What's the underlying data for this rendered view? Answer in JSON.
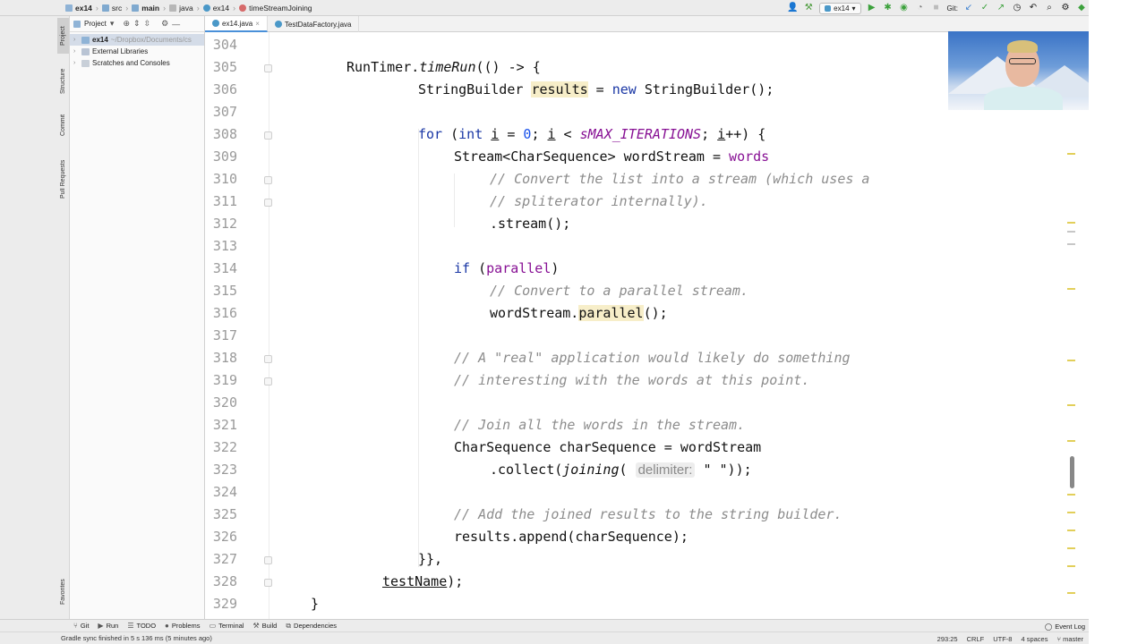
{
  "breadcrumb": [
    {
      "label": "ex14",
      "icon": "folder-icon"
    },
    {
      "label": "src",
      "icon": "source-folder-icon"
    },
    {
      "label": "main",
      "icon": "source-folder-icon"
    },
    {
      "label": "java",
      "icon": "package-icon"
    },
    {
      "label": "ex14",
      "icon": "class-icon"
    },
    {
      "label": "timeStreamJoining",
      "icon": "method-icon"
    }
  ],
  "toolbar": {
    "run_config": "ex14",
    "git_label": "Git:"
  },
  "left_stripe": {
    "project": "Project",
    "structure": "Structure",
    "commit": "Commit",
    "pull_requests": "Pull Requests",
    "favorites": "Favorites"
  },
  "project_panel": {
    "title": "Project",
    "tree": [
      {
        "label": "ex14",
        "sub": "~/Dropbox/Documents/cs",
        "selected": true
      },
      {
        "label": "External Libraries",
        "sub": ""
      },
      {
        "label": "Scratches and Consoles",
        "sub": ""
      }
    ]
  },
  "editor_tabs": [
    {
      "label": "ex14.java",
      "active": true
    },
    {
      "label": "TestDataFactory.java",
      "active": false
    }
  ],
  "editor": {
    "line_numbers": [
      "304",
      "305",
      "306",
      "307",
      "308",
      "309",
      "310",
      "311",
      "312",
      "313",
      "314",
      "315",
      "316",
      "317",
      "318",
      "319",
      "320",
      "321",
      "322",
      "323",
      "324",
      "325",
      "326",
      "327",
      "328",
      "329"
    ],
    "lines": {
      "l305a": "RunTimer.",
      "l305b": "timeRun",
      "l305c": "(() -> {",
      "l306a": "StringBuilder ",
      "l306b": "results",
      "l306c": " = ",
      "l306d": "new",
      "l306e": " StringBuilder();",
      "l308a": "for",
      "l308b": " (",
      "l308c": "int",
      "l308d": " ",
      "l308e": "i",
      "l308f": " = ",
      "l308g": "0",
      "l308h": "; ",
      "l308i": "i",
      "l308j": " < ",
      "l308k": "sMAX_ITERATIONS",
      "l308l": "; ",
      "l308m": "i",
      "l308n": "++) {",
      "l309a": "Stream<CharSequence> wordStream = ",
      "l309b": "words",
      "l310": "// Convert the list into a stream (which uses a",
      "l311": "// spliterator internally).",
      "l312": ".stream();",
      "l314a": "if",
      "l314b": " (",
      "l314c": "parallel",
      "l314d": ")",
      "l315": "// Convert to a parallel stream.",
      "l316a": "wordStream.",
      "l316b": "parallel",
      "l316c": "();",
      "l318": "// A \"real\" application would likely do something",
      "l319": "// interesting with the words at this point.",
      "l321": "// Join all the words in the stream.",
      "l322": "CharSequence charSequence = wordStream",
      "l323a": ".collect(",
      "l323b": "joining",
      "l323c": "( ",
      "l323d": "delimiter:",
      "l323e": " \" \"",
      "l323f": "));",
      "l325": "// Add the joined results to the string builder.",
      "l326": "results.append(charSequence);",
      "l327": "}},",
      "l328a": "testName",
      "l328b": ");",
      "l329": "}"
    }
  },
  "bottom_tools": [
    {
      "label": "Git",
      "icon": "git-icon"
    },
    {
      "label": "Run",
      "icon": "run-icon"
    },
    {
      "label": "TODO",
      "icon": "todo-icon"
    },
    {
      "label": "Problems",
      "icon": "problems-icon"
    },
    {
      "label": "Terminal",
      "icon": "terminal-icon"
    },
    {
      "label": "Build",
      "icon": "build-icon"
    },
    {
      "label": "Dependencies",
      "icon": "dependencies-icon"
    }
  ],
  "event_log": "Event Log",
  "status": {
    "message": "Gradle sync finished in 5 s 136 ms (5 minutes ago)",
    "position": "293:25",
    "line_sep": "CRLF",
    "encoding": "UTF-8",
    "indent": "4 spaces",
    "branch": "master"
  },
  "colors": {
    "keyword": "#1a37a5",
    "comment": "#8c8c8c",
    "field": "#871094",
    "number": "#1750eb",
    "highlight": "#f7eec9"
  }
}
